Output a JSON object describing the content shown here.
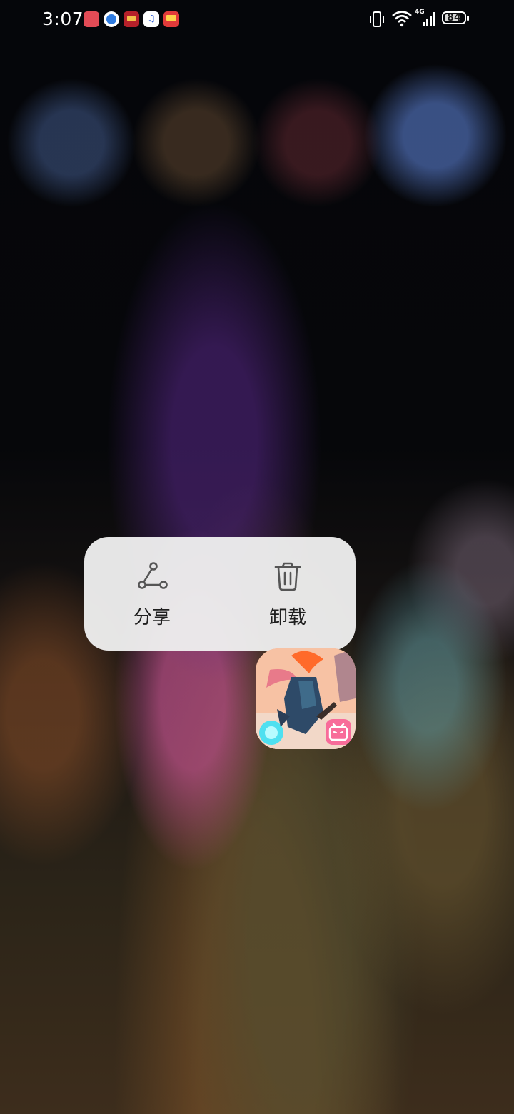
{
  "status_bar": {
    "time": "3:07",
    "notification_icons": [
      "huawei-icon",
      "browser-icon",
      "game-icon",
      "music-icon",
      "notes-icon"
    ],
    "network_label": "4G",
    "battery_level": "84"
  },
  "context_menu": {
    "items": [
      {
        "label": "分享",
        "icon": "share-icon"
      },
      {
        "label": "卸载",
        "icon": "trash-icon"
      }
    ]
  },
  "app": {
    "icon": "game-app-icon",
    "badge_icon": "bilibili-badge-icon"
  },
  "colors": {
    "menu_background": "#eeeeee",
    "menu_text": "#1f1f1f",
    "icon_stroke": "#555555"
  }
}
